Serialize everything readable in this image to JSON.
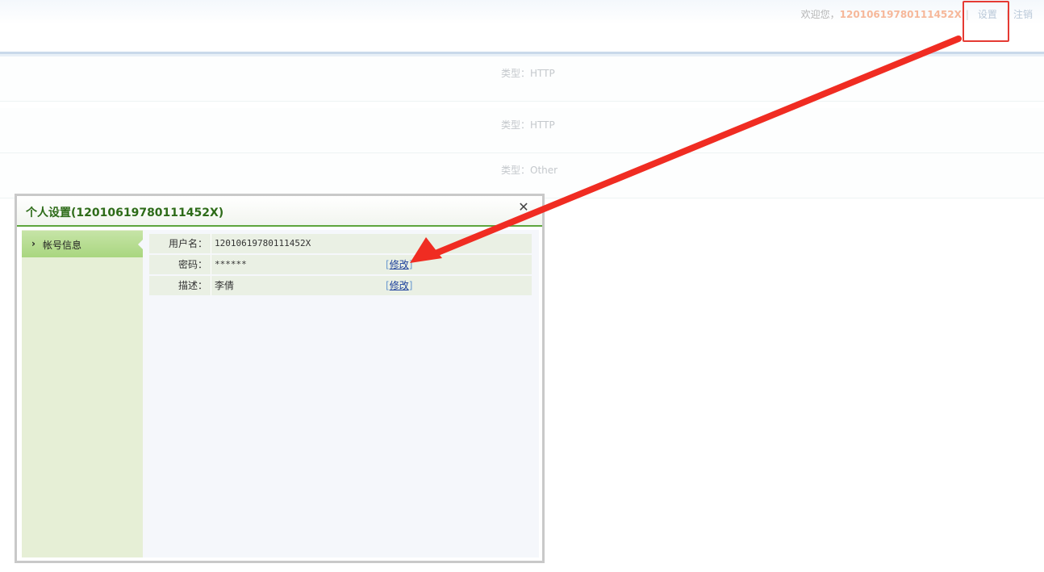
{
  "header": {
    "welcome_text": "欢迎您，",
    "user_id": "12010619780111452X",
    "separator": "|",
    "settings_link": "设置",
    "logout_link": "注销"
  },
  "rows": [
    {
      "type_label": "类型：HTTP"
    },
    {
      "type_label": "类型：HTTP"
    },
    {
      "type_label": "类型：Other"
    }
  ],
  "dialog": {
    "title": "个人设置(12010619780111452X)",
    "close_glyph": "✕",
    "sidebar": {
      "items": [
        {
          "label": "帐号信息",
          "chevron": "›"
        }
      ]
    },
    "fields": [
      {
        "label": "用户名：",
        "value": "12010619780111452X",
        "edit_open": "",
        "edit_label": "",
        "edit_close": ""
      },
      {
        "label": "密码：",
        "value": "******",
        "edit_open": "[",
        "edit_label": "修改",
        "edit_close": "]"
      },
      {
        "label": "描述：",
        "value": "李倩",
        "edit_open": "[",
        "edit_label": "修改",
        "edit_close": "]"
      }
    ]
  },
  "annotation": {
    "box_color": "#e53a33",
    "arrow_color": "#f02c22"
  }
}
